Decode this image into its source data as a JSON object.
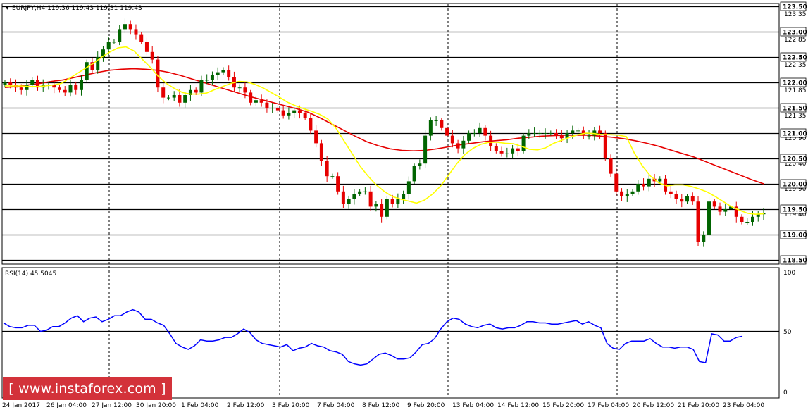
{
  "header": {
    "symbol_line": "EURJPY,H4  119.36 119.43 119.31 119.43"
  },
  "rsi_panel": {
    "label": "RSI(14) 45.5045",
    "scale_top": "100",
    "scale_mid": "50",
    "scale_bottom": "0"
  },
  "banner": {
    "text": "[ www.instaforex.com ]"
  },
  "colors": {
    "bull_candle": "#006400",
    "bear_candle": "#e60000",
    "fast_ma": "#ffff00",
    "slow_ma": "#e60000",
    "rsi_line": "#0000ff",
    "level_line": "#000000",
    "banner": "#d3323a"
  },
  "chart_data": [
    {
      "type": "candlestick",
      "title": "EURJPY,H4",
      "ylim": [
        118.45,
        123.55
      ],
      "price_ticks": [
        "123.35",
        "122.85",
        "122.35",
        "121.85",
        "121.35",
        "120.90",
        "120.40",
        "119.90",
        "119.40",
        "118.95",
        "118.45"
      ],
      "level_labels": [
        "123.50",
        "123.00",
        "122.50",
        "122.00",
        "121.50",
        "121.00",
        "120.50",
        "120.00",
        "119.50",
        "119.00",
        "118.50"
      ],
      "horizontal_levels": [
        123.5,
        123.0,
        122.5,
        122.0,
        121.5,
        121.0,
        120.5,
        120.0,
        119.5,
        119.0,
        118.5
      ],
      "date_labels": [
        "24 Jan 2017",
        "26 Jan 04:00",
        "27 Jan 12:00",
        "30 Jan 20:00",
        "1 Feb 04:00",
        "2 Feb 12:00",
        "3 Feb 20:00",
        "7 Feb 04:00",
        "8 Feb 12:00",
        "9 Feb 20:00",
        "13 Feb 04:00",
        "14 Feb 12:00",
        "15 Feb 20:00",
        "17 Feb 04:00",
        "20 Feb 12:00",
        "21 Feb 20:00",
        "23 Feb 04:00"
      ],
      "close": [
        122.0,
        121.95,
        121.9,
        121.85,
        121.95,
        122.05,
        121.9,
        121.95,
        121.95,
        121.9,
        121.85,
        121.8,
        121.95,
        121.85,
        122.05,
        122.4,
        122.25,
        122.5,
        122.65,
        122.8,
        122.8,
        123.05,
        123.15,
        123.05,
        122.95,
        122.8,
        122.6,
        122.45,
        121.9,
        121.7,
        121.7,
        121.75,
        121.6,
        121.75,
        121.85,
        121.8,
        122.05,
        122.05,
        122.15,
        122.2,
        122.25,
        122.1,
        121.9,
        121.9,
        121.8,
        121.6,
        121.65,
        121.6,
        121.5,
        121.5,
        121.45,
        121.35,
        121.4,
        121.45,
        121.4,
        121.3,
        121.05,
        120.8,
        120.45,
        120.15,
        120.15,
        119.85,
        119.6,
        119.7,
        119.8,
        119.85,
        119.85,
        119.55,
        119.6,
        119.35,
        119.7,
        119.6,
        119.7,
        119.8,
        120.05,
        120.35,
        120.4,
        120.95,
        121.25,
        121.25,
        121.1,
        120.95,
        120.8,
        120.7,
        120.85,
        121.0,
        121.0,
        121.1,
        120.95,
        120.75,
        120.65,
        120.6,
        120.6,
        120.7,
        120.65,
        120.95,
        121.0,
        121.0,
        121.0,
        121.0,
        121.0,
        120.95,
        120.9,
        121.0,
        121.05,
        121.05,
        120.95,
        120.95,
        121.05,
        121.0,
        120.5,
        120.2,
        119.85,
        119.75,
        119.8,
        119.85,
        120.0,
        119.95,
        120.1,
        120.05,
        120.1,
        119.85,
        119.8,
        119.7,
        119.65,
        119.75,
        119.65,
        118.85,
        119.0,
        119.65,
        119.55,
        119.45,
        119.5,
        119.55,
        119.35,
        119.25,
        119.25,
        119.35,
        119.4,
        119.43
      ],
      "fast_ma_values": [
        121.93,
        121.93,
        121.93,
        121.92,
        121.92,
        121.93,
        121.95,
        121.98,
        122.08,
        122.18,
        122.28,
        122.38,
        122.5,
        122.6,
        122.68,
        122.7,
        122.62,
        122.46,
        122.3,
        122.12,
        121.98,
        121.88,
        121.8,
        121.77,
        121.77,
        121.79,
        121.86,
        121.92,
        121.98,
        122.02,
        122.01,
        121.96,
        121.89,
        121.8,
        121.71,
        121.61,
        121.54,
        121.48,
        121.43,
        121.37,
        121.28,
        121.1,
        120.85,
        120.6,
        120.35,
        120.15,
        119.98,
        119.85,
        119.75,
        119.7,
        119.66,
        119.62,
        119.68,
        119.8,
        119.96,
        120.18,
        120.4,
        120.58,
        120.7,
        120.78,
        120.82,
        120.82,
        120.8,
        120.79,
        120.74,
        120.68,
        120.67,
        120.71,
        120.8,
        120.86,
        120.92,
        120.97,
        121.0,
        120.99,
        120.97,
        120.97,
        120.96,
        120.93,
        120.6,
        120.35,
        120.15,
        120.02,
        119.96,
        119.98,
        119.98,
        119.95,
        119.9,
        119.84,
        119.75,
        119.65,
        119.55,
        119.48,
        119.42,
        119.4,
        119.41
      ],
      "slow_ma_values": [
        121.9,
        121.92,
        121.95,
        121.98,
        122.02,
        122.05,
        122.1,
        122.15,
        122.2,
        122.24,
        122.26,
        122.27,
        122.26,
        122.24,
        122.2,
        122.14,
        122.07,
        122.0,
        121.93,
        121.86,
        121.79,
        121.72,
        121.66,
        121.6,
        121.54,
        121.48,
        121.41,
        121.3,
        121.18,
        121.06,
        120.94,
        120.83,
        120.75,
        120.69,
        120.66,
        120.65,
        120.66,
        120.69,
        120.73,
        120.77,
        120.8,
        120.83,
        120.85,
        120.87,
        120.9,
        120.92,
        120.94,
        120.95,
        120.96,
        120.96,
        120.96,
        120.94,
        120.92,
        120.89,
        120.85,
        120.8,
        120.74,
        120.67,
        120.6,
        120.53,
        120.44,
        120.35,
        120.26,
        120.17,
        120.08,
        120.0
      ]
    },
    {
      "type": "line",
      "title": "RSI(14) 45.5045",
      "ylim": [
        0,
        100
      ],
      "y_ticks": [
        "100",
        "50",
        "0"
      ],
      "reference_level": 50,
      "values": [
        57,
        54,
        53,
        53,
        55,
        55,
        50,
        51,
        54,
        54,
        57,
        61,
        63,
        58,
        61,
        62,
        58,
        60,
        63,
        63,
        66,
        68,
        66,
        60,
        60,
        57,
        55,
        48,
        40,
        37,
        35,
        38,
        43,
        42,
        42,
        43,
        45,
        45,
        48,
        52,
        49,
        43,
        40,
        39,
        38,
        37,
        39,
        34,
        36,
        37,
        40,
        38,
        37,
        34,
        33,
        31,
        25,
        23,
        22,
        23,
        27,
        31,
        32,
        30,
        27,
        27,
        28,
        33,
        39,
        40,
        44,
        52,
        58,
        61,
        60,
        56,
        54,
        53,
        55,
        56,
        53,
        52,
        53,
        53,
        55,
        58,
        58,
        57,
        57,
        56,
        56,
        57,
        58,
        59,
        56,
        58,
        55,
        53,
        40,
        36,
        35,
        40,
        42,
        42,
        42,
        44,
        40,
        37,
        37,
        36,
        37,
        37,
        35,
        25,
        24,
        48,
        47,
        42,
        42,
        45,
        46
      ],
      "series": [
        {
          "name": "RSI(14)"
        }
      ]
    }
  ]
}
